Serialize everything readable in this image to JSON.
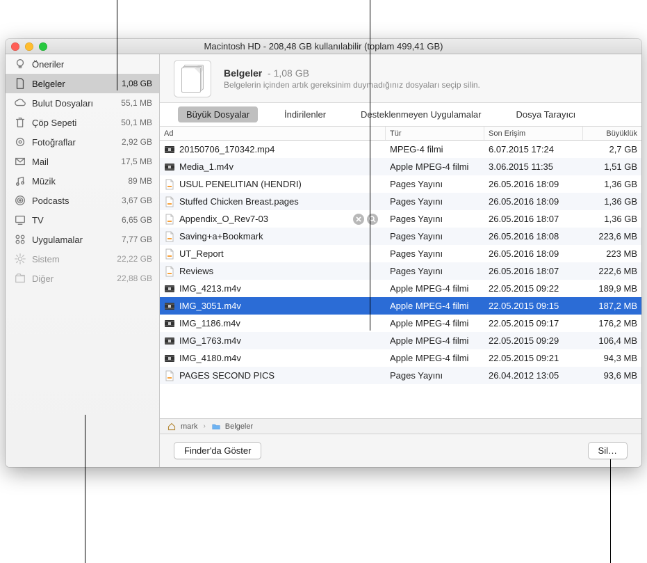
{
  "window": {
    "title": "Macintosh HD - 208,48 GB kullanılabilir (toplam 499,41 GB)"
  },
  "sidebar": {
    "items": [
      {
        "icon": "bulb",
        "label": "Öneriler",
        "size": "",
        "dim": false
      },
      {
        "icon": "doc",
        "label": "Belgeler",
        "size": "1,08 GB",
        "dim": false,
        "selected": true
      },
      {
        "icon": "cloud",
        "label": "Bulut Dosyaları",
        "size": "55,1 MB",
        "dim": false
      },
      {
        "icon": "trash",
        "label": "Çöp Sepeti",
        "size": "50,1 MB",
        "dim": false
      },
      {
        "icon": "photos",
        "label": "Fotoğraflar",
        "size": "2,92 GB",
        "dim": false
      },
      {
        "icon": "mail",
        "label": "Mail",
        "size": "17,5 MB",
        "dim": false
      },
      {
        "icon": "music",
        "label": "Müzik",
        "size": "89 MB",
        "dim": false
      },
      {
        "icon": "podcasts",
        "label": "Podcasts",
        "size": "3,67 GB",
        "dim": false
      },
      {
        "icon": "tv",
        "label": "TV",
        "size": "6,65 GB",
        "dim": false
      },
      {
        "icon": "apps",
        "label": "Uygulamalar",
        "size": "7,77 GB",
        "dim": false
      },
      {
        "icon": "system",
        "label": "Sistem",
        "size": "22,22 GB",
        "dim": true
      },
      {
        "icon": "other",
        "label": "Diğer",
        "size": "22,88 GB",
        "dim": true
      }
    ]
  },
  "header": {
    "title": "Belgeler",
    "size": "1,08 GB",
    "subtitle": "Belgelerin içinden artık gereksinim duymadığınız dosyaları seçip silin."
  },
  "tabs": [
    {
      "label": "Büyük Dosyalar",
      "active": true
    },
    {
      "label": "İndirilenler",
      "active": false
    },
    {
      "label": "Desteklenmeyen Uygulamalar",
      "active": false
    },
    {
      "label": "Dosya Tarayıcı",
      "active": false
    }
  ],
  "columns": {
    "name": "Ad",
    "type": "Tür",
    "date": "Son Erişim",
    "size": "Büyüklük"
  },
  "rows": [
    {
      "name": "20150706_170342.mp4",
      "type": "MPEG-4 filmi",
      "date": "6.07.2015 17:24",
      "size": "2,7 GB",
      "icon": "video"
    },
    {
      "name": "Media_1.m4v",
      "type": "Apple MPEG-4 filmi",
      "date": "3.06.2015 11:35",
      "size": "1,51 GB",
      "icon": "video"
    },
    {
      "name": "USUL PENELITIAN (HENDRI)",
      "type": "Pages Yayını",
      "date": "26.05.2016 18:09",
      "size": "1,36 GB",
      "icon": "pages"
    },
    {
      "name": "Stuffed Chicken Breast.pages",
      "type": "Pages Yayını",
      "date": "26.05.2016 18:09",
      "size": "1,36 GB",
      "icon": "pages"
    },
    {
      "name": "Appendix_O_Rev7-03",
      "type": "Pages Yayını",
      "date": "26.05.2016 18:07",
      "size": "1,36 GB",
      "icon": "pages",
      "hovered": true
    },
    {
      "name": "Saving+a+Bookmark",
      "type": "Pages Yayını",
      "date": "26.05.2016 18:08",
      "size": "223,6 MB",
      "icon": "pages"
    },
    {
      "name": "UT_Report",
      "type": "Pages Yayını",
      "date": "26.05.2016 18:09",
      "size": "223 MB",
      "icon": "pages"
    },
    {
      "name": "Reviews",
      "type": "Pages Yayını",
      "date": "26.05.2016 18:07",
      "size": "222,6 MB",
      "icon": "pages"
    },
    {
      "name": "IMG_4213.m4v",
      "type": "Apple MPEG-4 filmi",
      "date": "22.05.2015 09:22",
      "size": "189,9 MB",
      "icon": "video"
    },
    {
      "name": "IMG_3051.m4v",
      "type": "Apple MPEG-4 filmi",
      "date": "22.05.2015 09:15",
      "size": "187,2 MB",
      "icon": "video",
      "selected": true
    },
    {
      "name": "IMG_1186.m4v",
      "type": "Apple MPEG-4 filmi",
      "date": "22.05.2015 09:17",
      "size": "176,2 MB",
      "icon": "video"
    },
    {
      "name": "IMG_1763.m4v",
      "type": "Apple MPEG-4 filmi",
      "date": "22.05.2015 09:29",
      "size": "106,4 MB",
      "icon": "video"
    },
    {
      "name": "IMG_4180.m4v",
      "type": "Apple MPEG-4 filmi",
      "date": "22.05.2015 09:21",
      "size": "94,3 MB",
      "icon": "video"
    },
    {
      "name": "PAGES SECOND PICS",
      "type": "Pages Yayını",
      "date": "26.04.2012 13:05",
      "size": "93,6 MB",
      "icon": "pages"
    }
  ],
  "pathbar": {
    "home": "mark",
    "folder": "Belgeler"
  },
  "footer": {
    "show_in_finder": "Finder'da Göster",
    "delete": "Sil…"
  }
}
